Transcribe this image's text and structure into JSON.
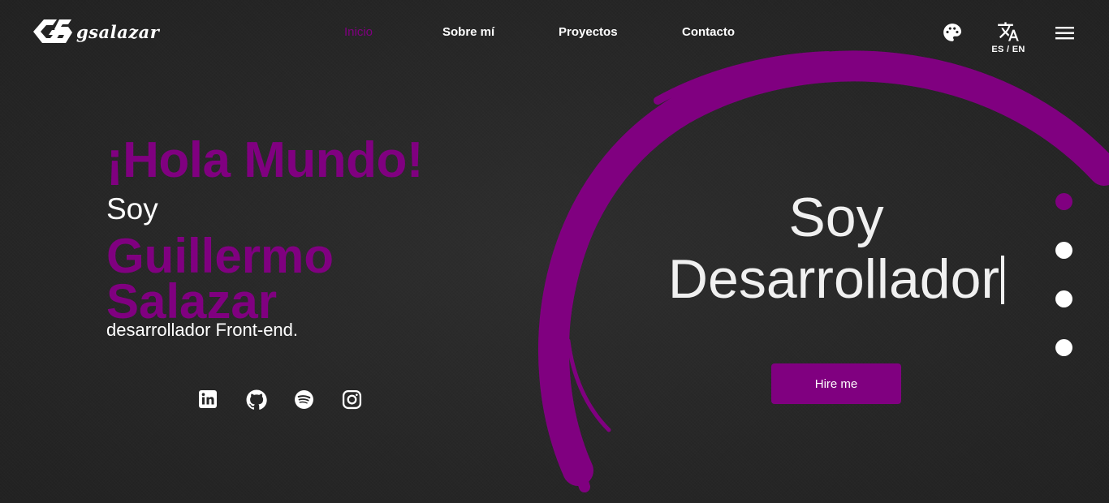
{
  "brand": {
    "logo_text": "gsalazar",
    "logo_icon": "gs-logo-icon"
  },
  "nav": {
    "items": [
      {
        "label": "Inicio",
        "active": true
      },
      {
        "label": "Sobre mí",
        "active": false
      },
      {
        "label": "Proyectos",
        "active": false
      },
      {
        "label": "Contacto",
        "active": false
      }
    ]
  },
  "tools": {
    "theme_icon": "palette-icon",
    "language_icon": "translate-icon",
    "language_label": "ES / EN",
    "menu_icon": "hamburger-menu-icon"
  },
  "hero": {
    "greeting": "¡Hola Mundo!",
    "intro": "Soy",
    "name": "Guillermo Salazar",
    "role": "desarrollador Front-end."
  },
  "socials": [
    {
      "name": "LinkedIn",
      "icon": "linkedin-icon"
    },
    {
      "name": "GitHub",
      "icon": "github-icon"
    },
    {
      "name": "Spotify",
      "icon": "spotify-icon"
    },
    {
      "name": "Instagram",
      "icon": "instagram-icon"
    }
  ],
  "typed": {
    "line1": "Soy",
    "line2": "Desarrollador"
  },
  "cta": {
    "label": "Hire me"
  },
  "section_dots": {
    "count": 4,
    "active_index": 0
  },
  "colors": {
    "accent": "#800080",
    "background": "#262626",
    "text": "#ffffff"
  }
}
